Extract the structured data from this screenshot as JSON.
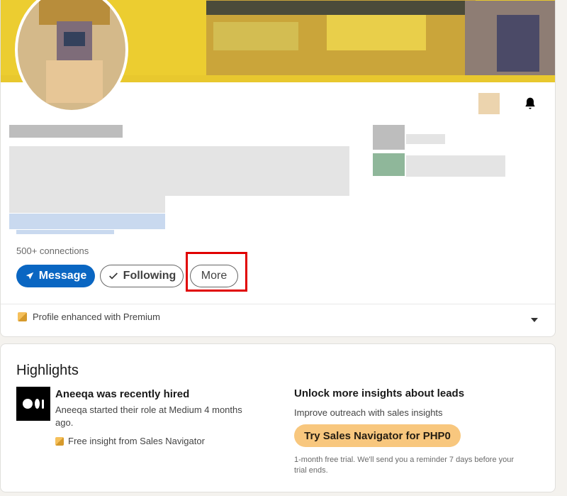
{
  "profile": {
    "connections": "500+ connections",
    "message_label": "Message",
    "following_label": "Following",
    "more_label": "More",
    "premium_text": "Profile enhanced with Premium"
  },
  "highlights": {
    "title": "Highlights",
    "hired_title": "Aneeqa was recently hired",
    "hired_desc": "Aneeqa started their role at Medium 4 months ago.",
    "free_insight": "Free insight from Sales Navigator",
    "unlock_title": "Unlock more insights about leads",
    "unlock_sub": "Improve outreach with sales insights",
    "try_label": "Try Sales Navigator for PHP0",
    "trial_note": "1-month free trial. We'll send you a reminder 7 days before your trial ends."
  },
  "colors": {
    "primary_blue": "#0a66c2",
    "premium_gold": "#f8c77e",
    "highlight_red": "#e00000"
  },
  "icons": [
    "bell-icon",
    "send-icon",
    "check-icon",
    "premium-icon",
    "caret-down-icon",
    "medium-logo"
  ]
}
